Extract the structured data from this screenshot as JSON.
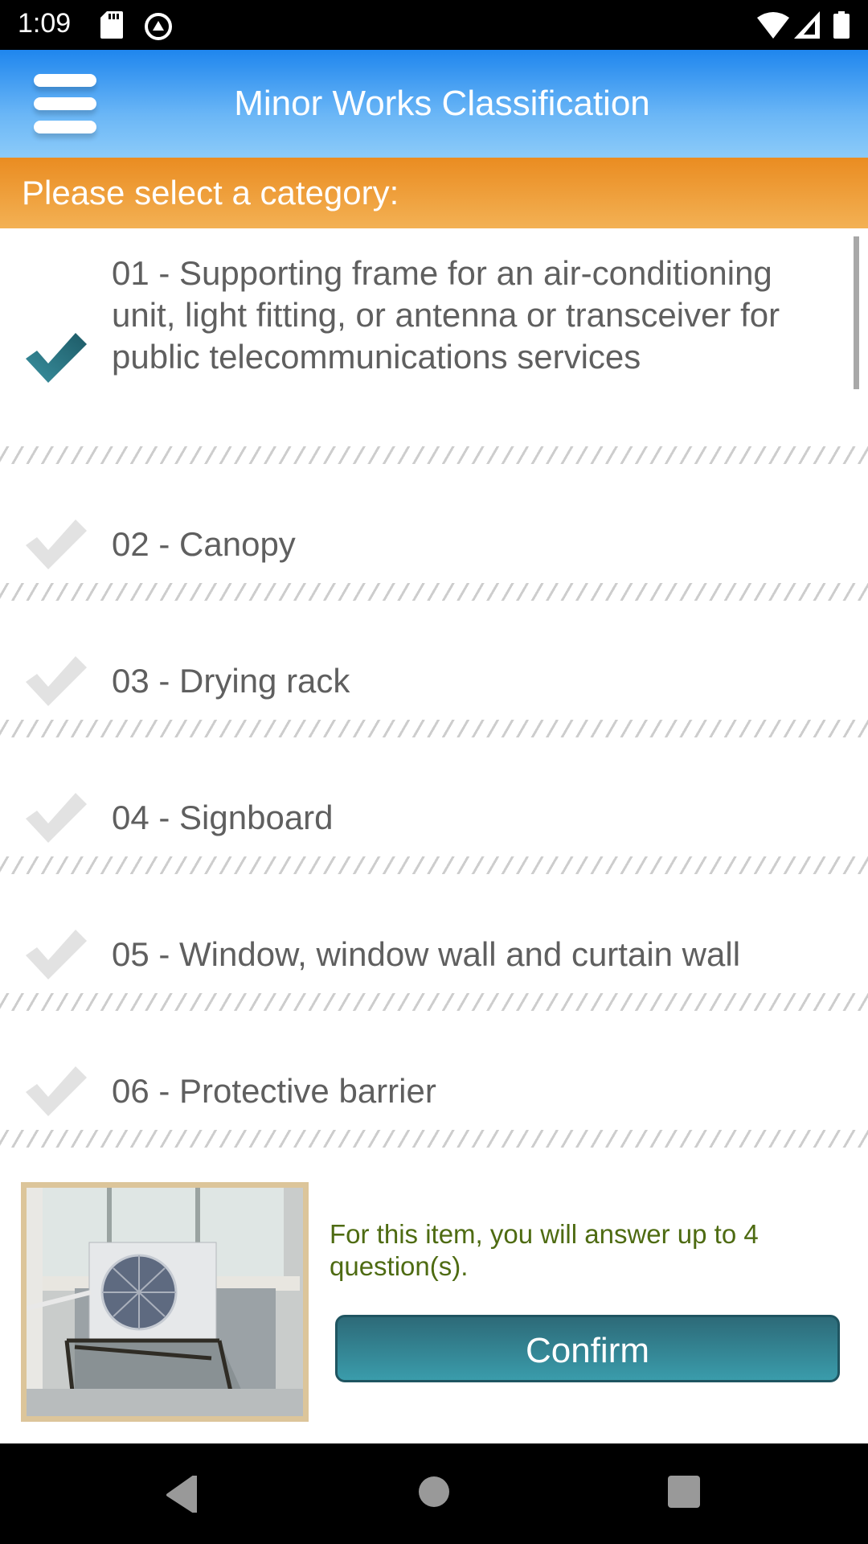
{
  "status_bar": {
    "time": "1:09",
    "left_icons": [
      "sd-card-icon",
      "vpn-icon"
    ],
    "right_icons": [
      "wifi-icon",
      "signal-icon",
      "battery-icon"
    ]
  },
  "header": {
    "menu_icon": "hamburger-menu-icon",
    "title": "Minor Works Classification"
  },
  "category_prompt": "Please select a category:",
  "categories": [
    {
      "label": "01 - Supporting frame for an air-conditioning unit, light fitting, or antenna or transceiver for public telecommunications services",
      "selected": true
    },
    {
      "label": "02 - Canopy",
      "selected": false
    },
    {
      "label": "03 - Drying rack",
      "selected": false
    },
    {
      "label": "04 - Signboard",
      "selected": false
    },
    {
      "label": "05 - Window, window wall and curtain wall",
      "selected": false
    },
    {
      "label": "06 - Protective barrier",
      "selected": false
    }
  ],
  "colors": {
    "selected_check": "#2a6f7d",
    "unselected_check": "#e2e2e2",
    "header_blue": "#1f86ee",
    "category_orange": "#ea8c21",
    "info_text": "#4e6b12",
    "confirm_button": "#2d6a78"
  },
  "footer": {
    "image_alt": "Air-conditioning unit on supporting frame",
    "info_text": "For this item, you will answer up to 4 question(s).",
    "confirm_label": "Confirm"
  },
  "nav_bar": {
    "buttons": [
      "back-icon",
      "home-icon",
      "recents-icon"
    ]
  }
}
